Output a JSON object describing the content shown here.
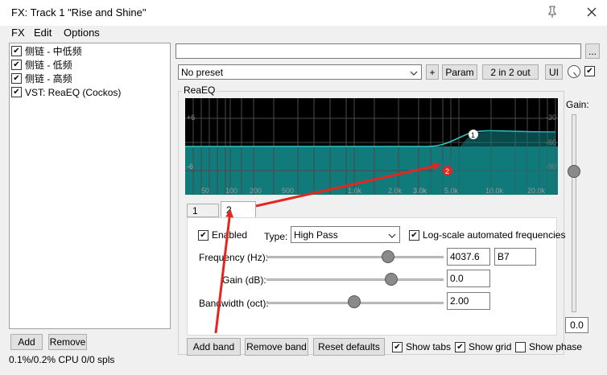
{
  "window": {
    "title": "FX: Track 1 \"Rise and Shine\"",
    "pin_icon": "pin-icon",
    "close_icon": "close-icon"
  },
  "menu": [
    "FX",
    "Edit",
    "Options"
  ],
  "fx_list": [
    {
      "label": "侧链 - 中低频",
      "enabled": true
    },
    {
      "label": "侧链 - 低频",
      "enabled": true
    },
    {
      "label": "侧链 - 高频",
      "enabled": true
    },
    {
      "label": "VST: ReaEQ (Cockos)",
      "enabled": true
    }
  ],
  "fx_buttons": {
    "add": "Add",
    "remove": "Remove"
  },
  "status": "0.1%/0.2% CPU 0/0 spls",
  "header": {
    "more": "...",
    "preset": "No preset",
    "plus": "+",
    "param": "Param",
    "io": "2 in 2 out",
    "ui": "UI",
    "bypass_enabled": true
  },
  "plugin": {
    "name": "ReaEQ"
  },
  "graph": {
    "y_labels": [
      "+6",
      "-6"
    ],
    "y_labels_right": [
      "-30",
      "-60",
      "-90"
    ],
    "x_labels": [
      "50",
      "100",
      "200",
      "500",
      "1.0k",
      "2.0k",
      "5.0k",
      "10.0k",
      "20.0k"
    ],
    "x_label_extra": "3.0k",
    "band_markers": [
      "1",
      "2"
    ],
    "curve_color": "#2ec4c4",
    "fill_color": "#117a7a",
    "selected_marker_color": "#e3261f"
  },
  "gain": {
    "label": "Gain:",
    "value": "0.0"
  },
  "tabs": [
    "1",
    "2"
  ],
  "band": {
    "enabled_label": "Enabled",
    "enabled": true,
    "type_label": "Type:",
    "type_value": "High Pass",
    "log_scale_label": "Log-scale automated frequencies",
    "log_scale": true,
    "frequency_label": "Frequency (Hz):",
    "frequency_value": "4037.6",
    "note_value": "B7",
    "gain_label": "Gain (dB):",
    "gain_value": "0.0",
    "bandwidth_label": "Bandwidth (oct):",
    "bandwidth_value": "2.00"
  },
  "bottom": {
    "add_band": "Add band",
    "remove_band": "Remove band",
    "reset_defaults": "Reset defaults",
    "show_tabs": "Show tabs",
    "show_tabs_checked": true,
    "show_grid": "Show grid",
    "show_grid_checked": true,
    "show_phase": "Show phase",
    "show_phase_checked": false
  },
  "annotation": {
    "arrow_color": "#e3261f"
  }
}
